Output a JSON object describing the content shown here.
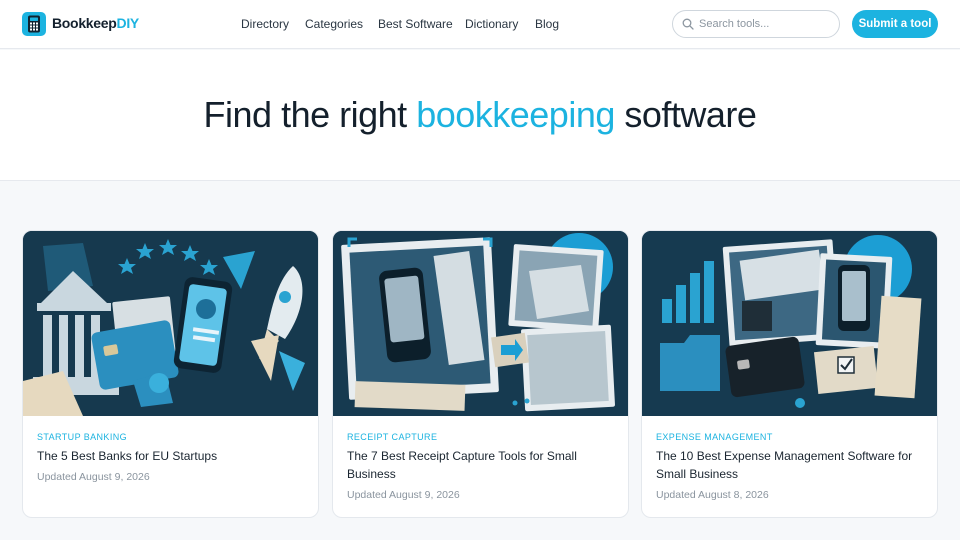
{
  "brand": {
    "name_main": "Bookkeep",
    "name_accent": "DIY",
    "logo_icon": "calculator-icon",
    "accent_color": "#1cb3e0"
  },
  "nav": [
    "Directory",
    "Categories",
    "Best Software",
    "Dictionary",
    "Blog"
  ],
  "search": {
    "placeholder": "Search tools...",
    "icon": "search-icon"
  },
  "submit_label": "Submit a tool",
  "hero": {
    "title_pre": "Find the right",
    "title_highlight": "bookkeeping",
    "title_post": "software"
  },
  "cards": [
    {
      "category": "STARTUP BANKING",
      "title": "The 5 Best Banks for EU Startups",
      "date": "Updated August 9, 2026",
      "image": "banking-collage-illustration"
    },
    {
      "category": "RECEIPT CAPTURE",
      "title": "The 7 Best Receipt Capture Tools for Small Business",
      "date": "Updated August 9, 2026",
      "image": "receipt-capture-collage-illustration"
    },
    {
      "category": "EXPENSE MANAGEMENT",
      "title": "The 10 Best Expense Management Software for Small Business",
      "date": "Updated August 8, 2026",
      "image": "expense-management-collage-illustration"
    }
  ]
}
